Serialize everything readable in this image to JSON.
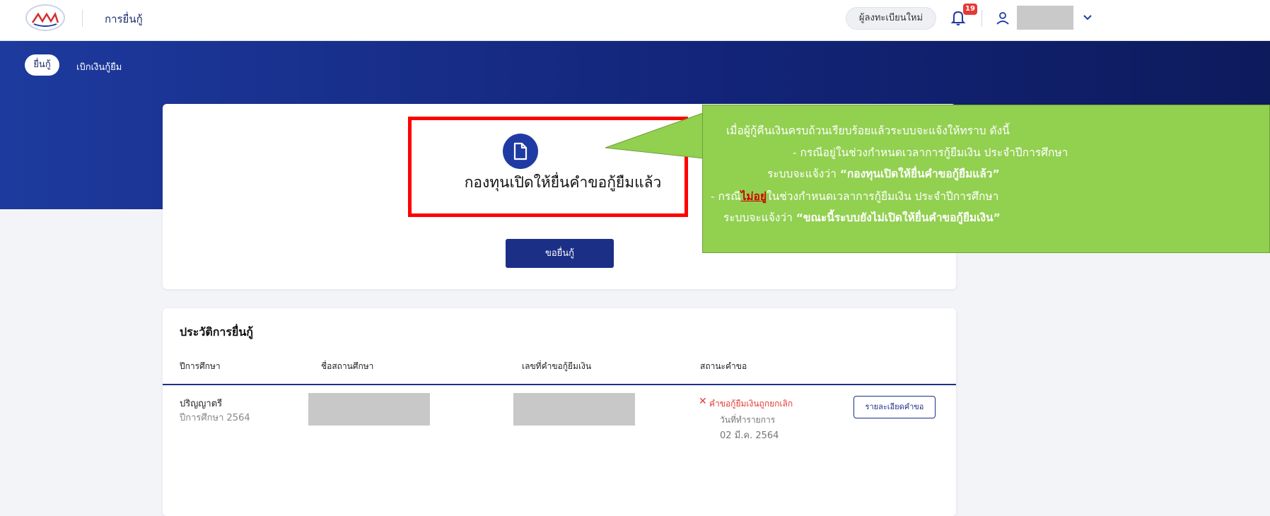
{
  "header": {
    "app_title": "การยื่นกู้",
    "register_label": "ผู้ลงทะเบียนใหม่",
    "notification_count": "19",
    "user_name": "",
    "logo_text": "กยศ"
  },
  "subnav": {
    "items": [
      {
        "label": "ยื่นกู้",
        "active": true
      },
      {
        "label": "เบิกเงินกู้ยืม",
        "active": false
      }
    ]
  },
  "main": {
    "message": "กองทุนเปิดให้ยื่นคำขอกู้ยืมแล้ว",
    "apply_button": "ขอยื่นกู้"
  },
  "callout": {
    "line1": "เมื่อผู้กู้คืนเงินครบถ้วนเรียบร้อยแล้วระบบจะแจ้งให้ทราบ ดังนี้",
    "line2": "- กรณีอยู่ในช่วงกำหนดเวลาการกู้ยืมเงิน ประจำปีการศึกษา",
    "line3_prefix": "ระบบจะแจ้งว่า ",
    "line3_bold": "“กองทุนเปิดให้ยื่นคำขอกู้ยืมแล้ว”",
    "line4_prefix": "- กรณี",
    "line4_underline": "ไม่อยู่",
    "line4_suffix": "ในช่วงกำหนดเวลาการกู้ยืมเงิน ประจำปีการศึกษา",
    "line5_prefix": "ระบบจะแจ้งว่า ",
    "line5_bold": "“ขณะนี้ระบบยังไม่เปิดให้ยื่นคำขอกู้ยืมเงิน”"
  },
  "history": {
    "title": "ประวัติการยื่นกู้",
    "columns": [
      "ปีการศึกษา",
      "ชื่อสถานศึกษา",
      "เลขที่คำขอกู้ยืมเงิน",
      "สถานะคำขอ"
    ],
    "rows": [
      {
        "level": "ปริญญาตรี",
        "year": "ปีการศึกษา 2564",
        "status": "คำขอกู้ยืมเงินถูกยกเลิก",
        "status_sub": "วันที่ทำรายการ",
        "status_date": "02 มี.ค. 2564",
        "detail_button": "รายละเอียดคำขอ"
      }
    ]
  },
  "colors": {
    "primary": "#1c2f86",
    "banner": "#1d3a9e",
    "highlight": "#ff0000",
    "callout": "#92d050",
    "status_error": "#e53935"
  }
}
